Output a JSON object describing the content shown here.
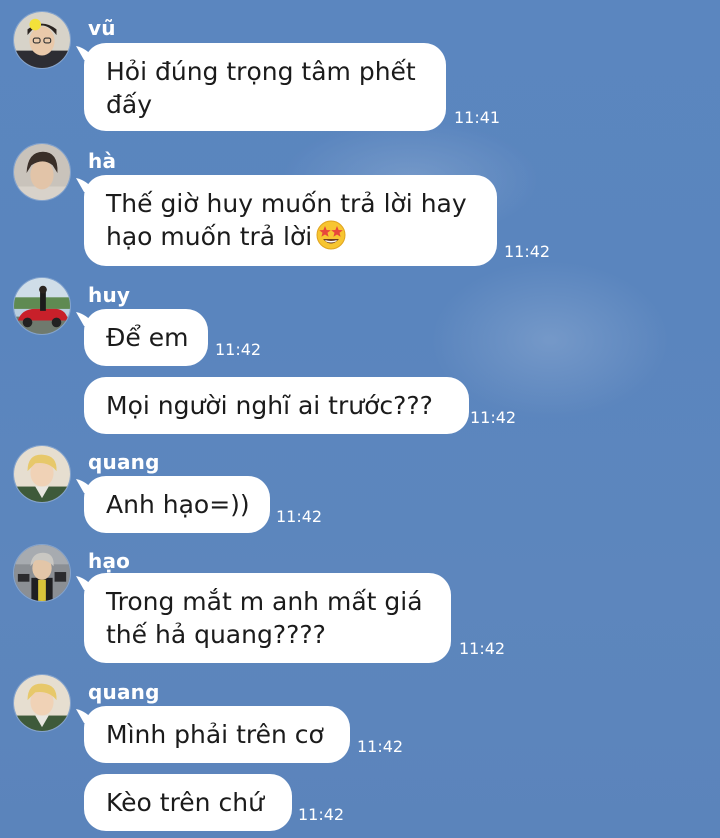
{
  "chat": {
    "messages": [
      {
        "sender": "vũ",
        "lines": [
          "Hỏi đúng trọng tâm phết",
          "đấy"
        ],
        "time": "11:41"
      },
      {
        "sender": "hà",
        "lines": [
          "Thế giờ huy muốn trả lời hay",
          "hạo muốn trả lời"
        ],
        "emoji": "star-struck-emoji",
        "time": "11:42"
      },
      {
        "sender": "huy",
        "lines": [
          "Để em"
        ],
        "time": "11:42"
      },
      {
        "sender": "huy",
        "lines": [
          "Mọi người nghĩ ai trước???"
        ],
        "time": "11:42"
      },
      {
        "sender": "quang",
        "lines": [
          "Anh hạo=))"
        ],
        "time": "11:42"
      },
      {
        "sender": "hạo",
        "lines": [
          "Trong mắt m anh mất giá",
          "thế hả quang????"
        ],
        "time": "11:42"
      },
      {
        "sender": "quang",
        "lines": [
          "Mình phải trên cơ"
        ],
        "time": "11:42"
      },
      {
        "sender": "quang",
        "lines": [
          "Kèo trên chứ"
        ],
        "time": "11:42"
      }
    ]
  },
  "colors": {
    "background": "#5b86bf",
    "bubble": "#ffffff",
    "text": "#1b1b1b",
    "meta_text": "#ffffff"
  }
}
